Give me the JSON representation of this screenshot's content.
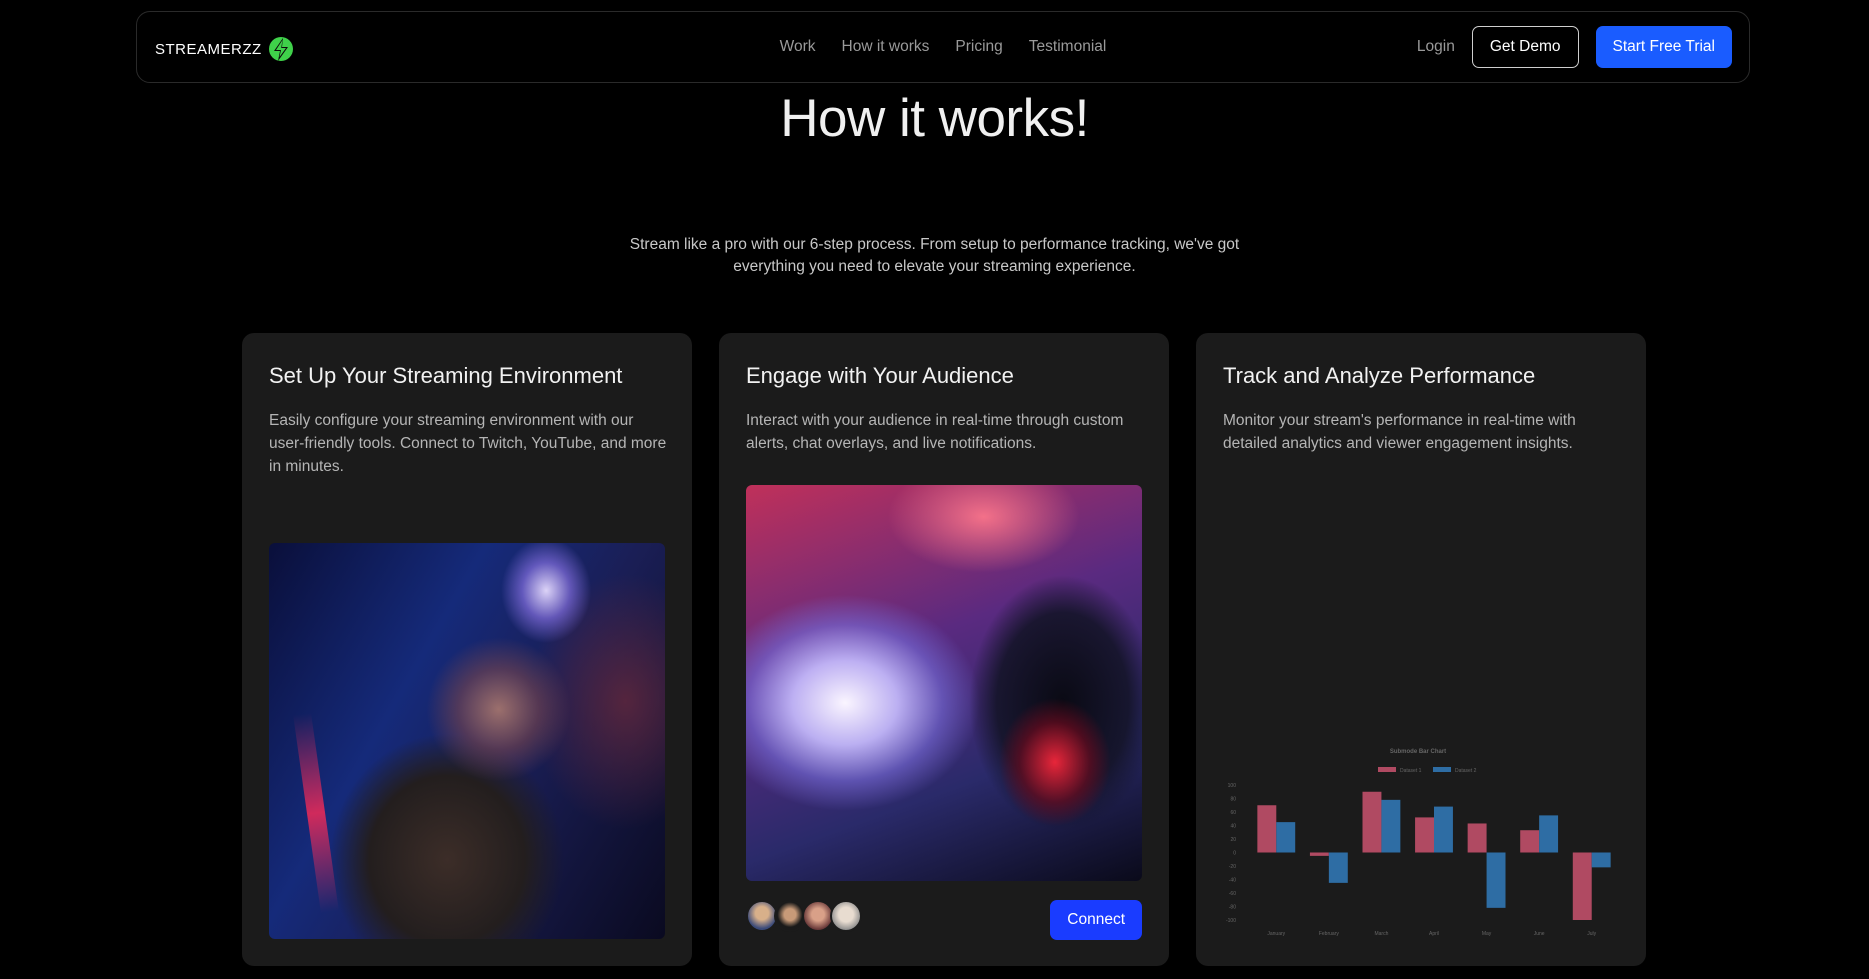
{
  "brand": {
    "name": "STREAMERZZ",
    "logo_icon": "lightning-bolt-icon"
  },
  "nav": {
    "links": [
      "Work",
      "How it works",
      "Pricing",
      "Testimonial"
    ],
    "login": "Login",
    "demo": "Get Demo",
    "trial": "Start Free Trial"
  },
  "hero": {
    "title": "How it works!",
    "subtitle_line1": "Stream like a pro with our 6-step process. From setup to performance tracking, we've got",
    "subtitle_line2": "everything you need to elevate your streaming experience."
  },
  "cards": [
    {
      "title": "Set Up Your Streaming Environment",
      "desc": "Easily configure your streaming environment with our user-friendly tools. Connect to Twitch, YouTube, and more in minutes."
    },
    {
      "title": "Engage with Your Audience",
      "desc": "Interact with your audience in real-time through custom alerts, chat overlays, and live notifications.",
      "button": "Connect"
    },
    {
      "title": "Track and Analyze Performance",
      "desc": "Monitor your stream's performance in real-time with detailed analytics and viewer engagement insights."
    }
  ],
  "colors": {
    "accent": "#1a5cff",
    "connect": "#1a3cff",
    "card_bg": "#1b1b1b",
    "dataset1": "#b04a62",
    "dataset2": "#2e6da4"
  },
  "chart_data": {
    "type": "bar",
    "title": "Submode Bar Chart",
    "categories": [
      "January",
      "February",
      "March",
      "April",
      "May",
      "June",
      "July"
    ],
    "series": [
      {
        "name": "Dataset 1",
        "values": [
          70,
          -5,
          90,
          52,
          43,
          33,
          -100
        ]
      },
      {
        "name": "Dataset 2",
        "values": [
          45,
          -45,
          78,
          68,
          -82,
          55,
          -22
        ]
      }
    ],
    "ylim": [
      -100,
      100
    ],
    "yticks": [
      100,
      80,
      60,
      40,
      20,
      0,
      -20,
      -40,
      -60,
      -80,
      -100
    ],
    "legend": "top"
  }
}
